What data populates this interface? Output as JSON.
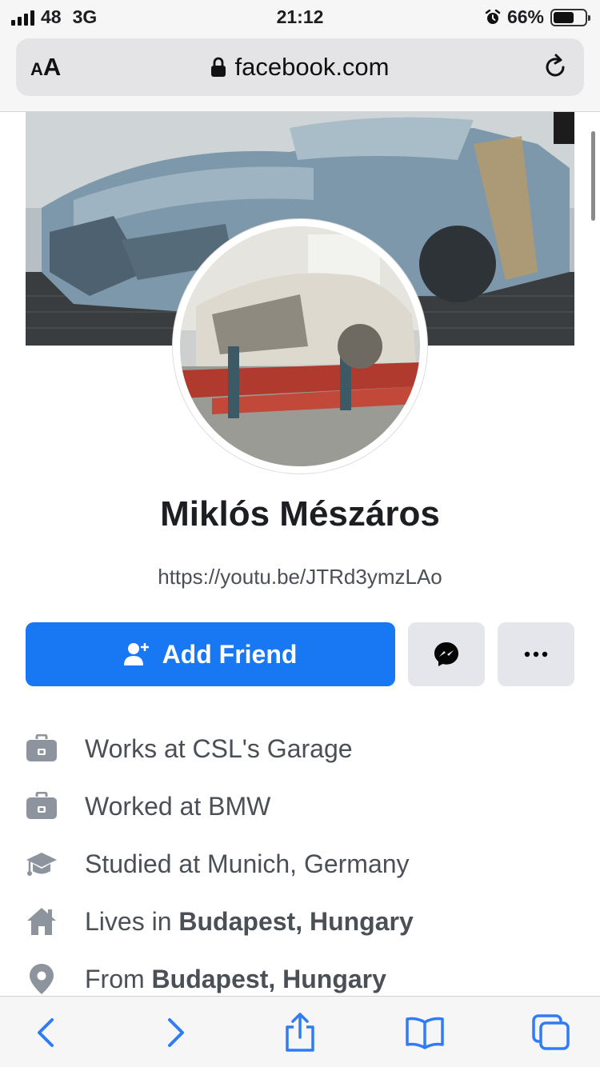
{
  "status_bar": {
    "signal": "48",
    "network": "3G",
    "time": "21:12",
    "battery_pct": "66%",
    "battery_level": 0.66,
    "alarm_icon": "alarm-icon"
  },
  "browser": {
    "text_size_small": "A",
    "text_size_big": "A",
    "domain": "facebook.com",
    "lock_icon": "lock-icon",
    "reload_icon": "reload-icon"
  },
  "profile": {
    "name": "Miklós Mészáros",
    "bio": "https://youtu.be/JTRd3ymzLAo",
    "add_friend_label": "Add Friend",
    "add_friend_icon": "add-person-icon",
    "messenger_icon": "messenger-icon",
    "more_icon": "more-dots-icon",
    "accent_color": "#1877f2"
  },
  "intro": [
    {
      "icon": "briefcase-icon",
      "prefix": "Works at CSL's Garage",
      "bold": ""
    },
    {
      "icon": "briefcase-icon",
      "prefix": "Worked at BMW",
      "bold": ""
    },
    {
      "icon": "graduation-cap-icon",
      "prefix": "Studied at Munich, Germany",
      "bold": ""
    },
    {
      "icon": "home-icon",
      "prefix": "Lives in ",
      "bold": "Budapest, Hungary"
    },
    {
      "icon": "location-pin-icon",
      "prefix": "From ",
      "bold": "Budapest, Hungary"
    }
  ],
  "toolbar": {
    "back_icon": "back-icon",
    "forward_icon": "forward-icon",
    "share_icon": "share-icon",
    "bookmarks_icon": "bookmarks-icon",
    "tabs_icon": "tabs-icon",
    "tint": "#2f7cf6"
  }
}
